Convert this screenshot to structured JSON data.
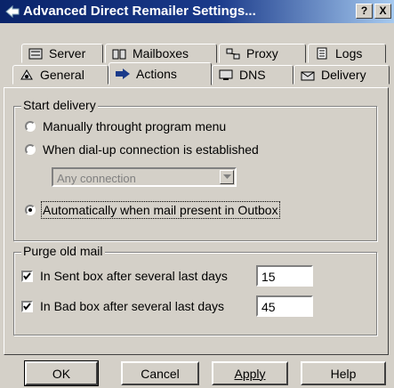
{
  "window": {
    "title": "Advanced Direct Remailer Settings...",
    "help_btn": "?",
    "close_btn": "X"
  },
  "tabs_back": [
    {
      "label": "Server",
      "icon": "server-icon"
    },
    {
      "label": "Mailboxes",
      "icon": "mailboxes-icon"
    },
    {
      "label": "Proxy",
      "icon": "proxy-icon"
    },
    {
      "label": "Logs",
      "icon": "logs-icon"
    }
  ],
  "tabs_front": [
    {
      "label": "General",
      "icon": "general-icon"
    },
    {
      "label": "Actions",
      "icon": "actions-arrow-icon",
      "active": true
    },
    {
      "label": "DNS",
      "icon": "dns-icon"
    },
    {
      "label": "Delivery",
      "icon": "delivery-icon"
    }
  ],
  "start_delivery": {
    "legend": "Start delivery",
    "opt_manual": "Manually throught program menu",
    "opt_dialup": "When dial-up connection is established",
    "connection_select": "Any connection",
    "opt_auto": "Automatically when mail present in Outbox",
    "selected": "auto"
  },
  "purge": {
    "legend": "Purge old mail",
    "sent_label": "In Sent box after several last days",
    "sent_checked": true,
    "sent_days": "15",
    "bad_label": "In Bad box after several last days",
    "bad_checked": true,
    "bad_days": "45"
  },
  "buttons": {
    "ok": "OK",
    "cancel": "Cancel",
    "apply": "Apply",
    "help": "Help"
  }
}
